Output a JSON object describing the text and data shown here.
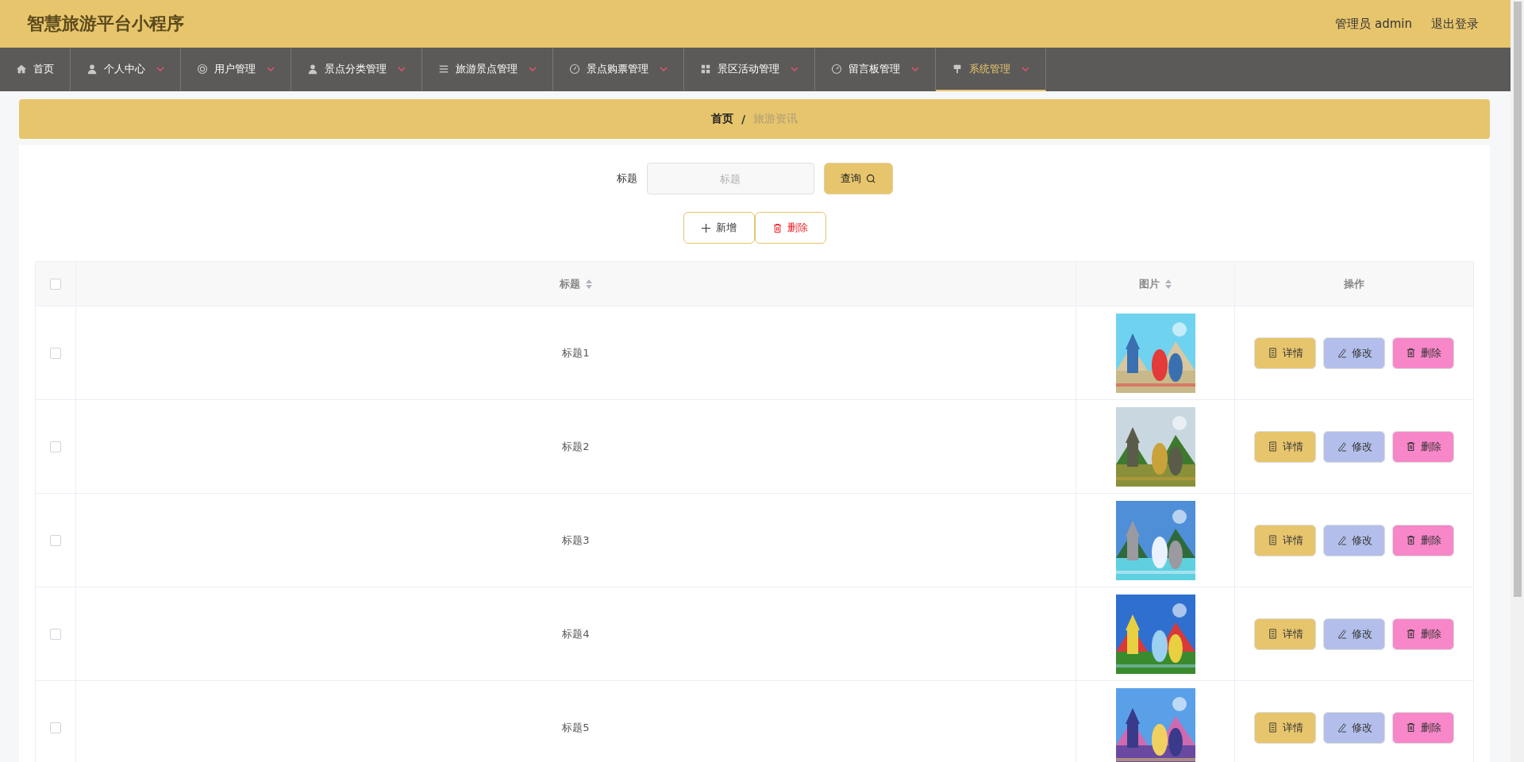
{
  "header": {
    "title": "智慧旅游平台小程序",
    "user_label": "管理员 admin",
    "logout": "退出登录"
  },
  "nav": [
    {
      "label": "首页",
      "dropdown": false,
      "selected": false
    },
    {
      "label": "个人中心",
      "dropdown": true,
      "selected": false
    },
    {
      "label": "用户管理",
      "dropdown": true,
      "selected": false
    },
    {
      "label": "景点分类管理",
      "dropdown": true,
      "selected": false
    },
    {
      "label": "旅游景点管理",
      "dropdown": true,
      "selected": false
    },
    {
      "label": "景点购票管理",
      "dropdown": true,
      "selected": false
    },
    {
      "label": "景区活动管理",
      "dropdown": true,
      "selected": false
    },
    {
      "label": "留言板管理",
      "dropdown": true,
      "selected": false
    },
    {
      "label": "系统管理",
      "dropdown": true,
      "selected": true
    }
  ],
  "breadcrumb": [
    {
      "label": "首页",
      "current": false
    },
    {
      "label": "旅游资讯",
      "current": true
    }
  ],
  "breadcrumb_separator": "/",
  "search": {
    "label": "标题",
    "placeholder": "标题",
    "button": "查询"
  },
  "actions": [
    {
      "label": "新增",
      "kind": "add"
    },
    {
      "label": "删除",
      "kind": "delete"
    }
  ],
  "table": {
    "select_all_checked": false,
    "columns": [
      {
        "label": "标题",
        "sortable": true
      },
      {
        "label": "图片",
        "sortable": true
      },
      {
        "label": "操作",
        "sortable": false
      }
    ],
    "rows": [
      {
        "checked": false,
        "title": "标题1",
        "actions": [
          {
            "label": "详情",
            "kind": "detail"
          },
          {
            "label": "修改",
            "kind": "edit"
          },
          {
            "label": "删除",
            "kind": "delete"
          }
        ]
      },
      {
        "checked": false,
        "title": "标题2",
        "actions": [
          {
            "label": "详情",
            "kind": "detail"
          },
          {
            "label": "修改",
            "kind": "edit"
          },
          {
            "label": "删除",
            "kind": "delete"
          }
        ]
      },
      {
        "checked": false,
        "title": "标题3",
        "actions": [
          {
            "label": "详情",
            "kind": "detail"
          },
          {
            "label": "修改",
            "kind": "edit"
          },
          {
            "label": "删除",
            "kind": "delete"
          }
        ]
      },
      {
        "checked": false,
        "title": "标题4",
        "actions": [
          {
            "label": "详情",
            "kind": "detail"
          },
          {
            "label": "修改",
            "kind": "edit"
          },
          {
            "label": "删除",
            "kind": "delete"
          }
        ]
      },
      {
        "checked": false,
        "title": "标题5",
        "actions": [
          {
            "label": "详情",
            "kind": "detail"
          },
          {
            "label": "修改",
            "kind": "edit"
          },
          {
            "label": "删除",
            "kind": "delete"
          }
        ]
      }
    ]
  }
}
